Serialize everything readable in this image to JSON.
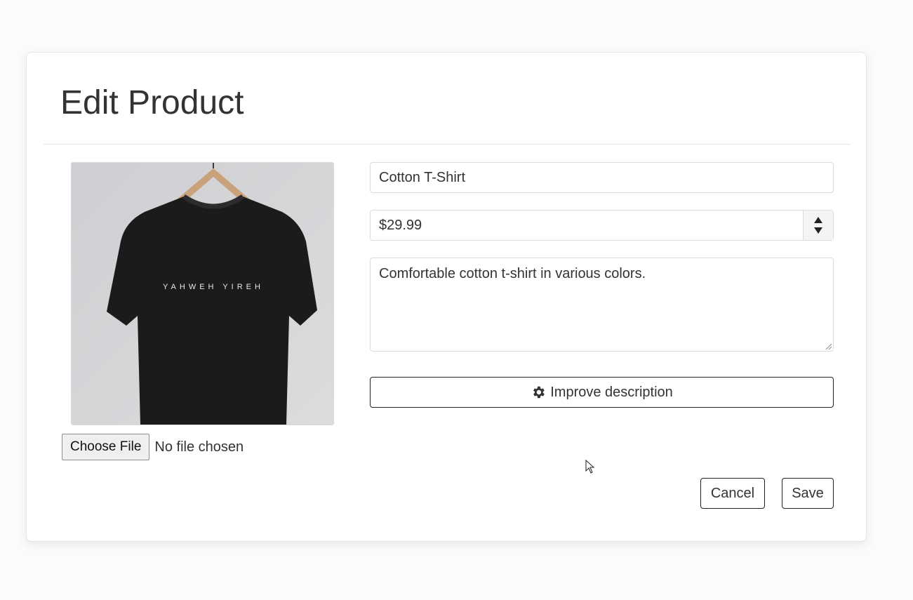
{
  "modal": {
    "title": "Edit Product"
  },
  "product": {
    "name": "Cotton T-Shirt",
    "price": "$29.99",
    "description": "Comfortable cotton t-shirt in various colors.",
    "image_icon": "tshirt-photo",
    "shirt_print_text": "YAHWEH YIREH"
  },
  "file_input": {
    "button_label": "Choose File",
    "status": "No file chosen"
  },
  "actions": {
    "improve_label": "Improve description",
    "improve_icon": "gear-icon",
    "cancel_label": "Cancel",
    "save_label": "Save"
  },
  "colors": {
    "text": "#333333",
    "border": "#dcdcdc",
    "button_border": "#222222",
    "shirt": "#1b1b1c",
    "photo_background": "#d6d6d8"
  }
}
